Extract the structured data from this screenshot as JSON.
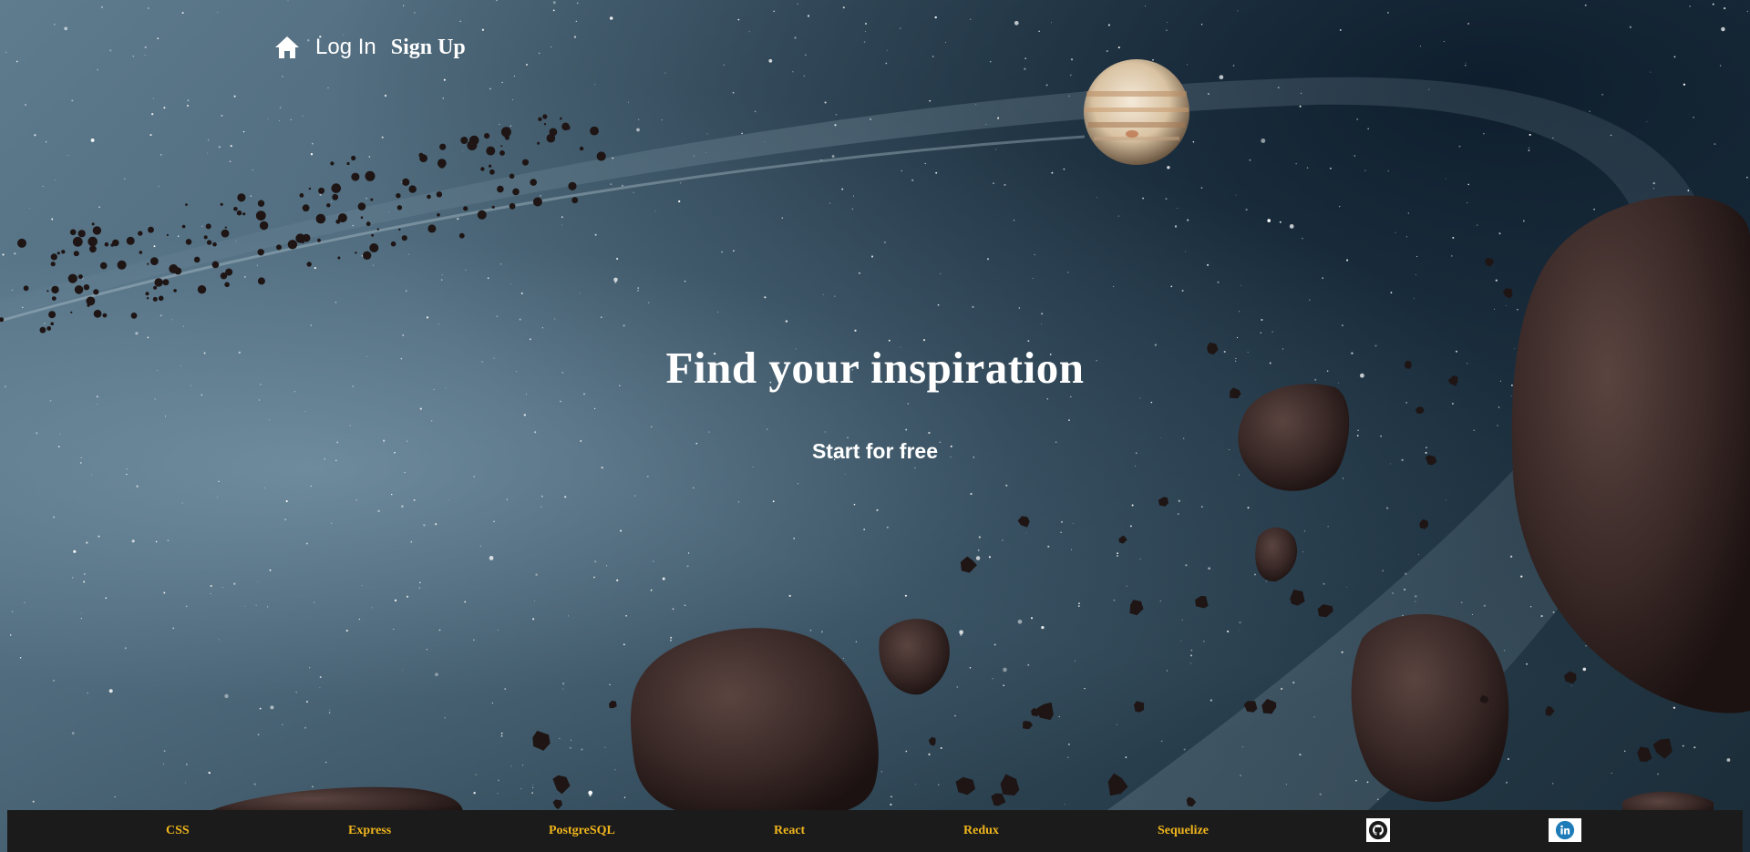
{
  "nav": {
    "home_icon": "home-icon",
    "login_label": "Log In",
    "signup_label": "Sign Up"
  },
  "hero": {
    "title": "Find your inspiration",
    "cta_label": "Start for free"
  },
  "footer": {
    "links": [
      "CSS",
      "Express",
      "PostgreSQL",
      "React",
      "Redux",
      "Sequelize"
    ],
    "github_icon": "github-icon",
    "linkedin_icon": "linkedin-icon",
    "link_color": "#f0b51d",
    "background": "#1b1b1b"
  },
  "colors": {
    "text": "#ffffff",
    "sky_light": "#5f7c8f",
    "sky_dark": "#1b2c38",
    "asteroid": "#3e2d2b"
  }
}
